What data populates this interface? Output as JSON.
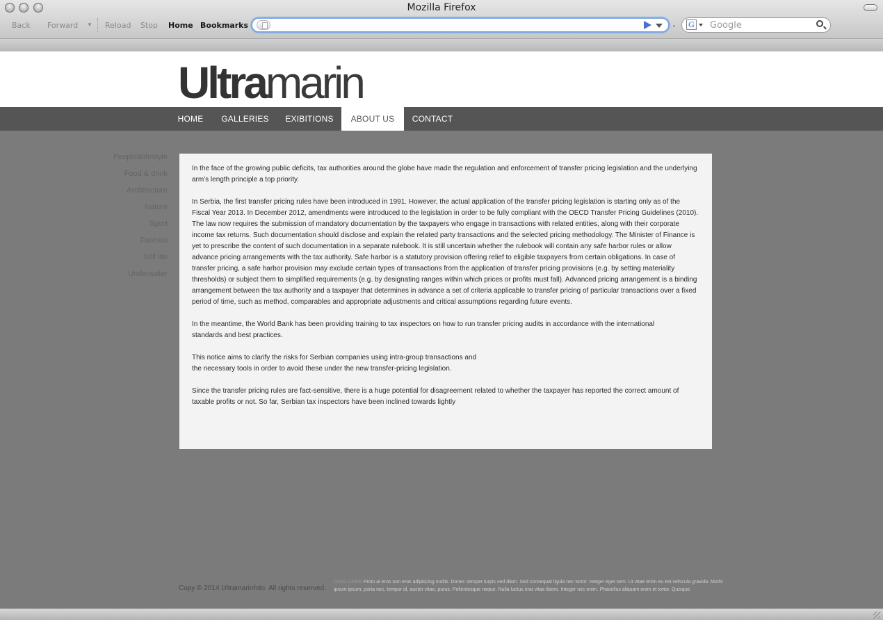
{
  "browser": {
    "title": "Mozilla Firefox",
    "toolbar": {
      "back": "Back",
      "forward": "Forward",
      "reload": "Reload",
      "stop": "Stop",
      "home": "Home",
      "bookmarks": "Bookmarks"
    },
    "url": {
      "value": ""
    },
    "search": {
      "placeholder": "Google",
      "engine_icon": "G"
    }
  },
  "site": {
    "logo_bold": "Ultra",
    "logo_light": "marin",
    "nav": [
      {
        "label": "HOME"
      },
      {
        "label": "GALLERIES"
      },
      {
        "label": "EXIBITIONS"
      },
      {
        "label": "ABOUT US",
        "active": true
      },
      {
        "label": "CONTACT"
      }
    ],
    "sidebar": [
      {
        "label": "People&lifestyle"
      },
      {
        "label": "Food & drink"
      },
      {
        "label": "Architecture"
      },
      {
        "label": "Nature"
      },
      {
        "label": "Sport"
      },
      {
        "label": "Fashion"
      },
      {
        "label": "Still life"
      },
      {
        "label": "Underwater"
      }
    ],
    "content": {
      "paragraphs": [
        "In the face of the growing public deficits, tax authorities around the globe have made the regulation and enforcement of transfer pricing legislation and the underlying arm's length principle a top priority.",
        "In Serbia, the first transfer pricing rules have been introduced in 1991. However, the actual application of the transfer pricing legislation is starting only as of the Fiscal Year 2013. In December 2012, amendments were introduced to the legislation in order to be fully compliant with the OECD Transfer Pricing Guidelines (2010).\nThe law now requires the submission of mandatory documentation by the taxpayers who engage in transactions with related entities, along with their corporate income tax returns. Such documentation should disclose and explain the related party transactions and the selected pricing methodology. The Minister of Finance is yet to prescribe the content of such documentation in a separate rulebook. It is still uncertain whether the rulebook will contain any safe harbor rules or allow advance pricing arrangements with the tax authority. Safe harbor is a statutory provision offering relief to eligible taxpayers from certain obligations. In case of transfer pricing, a safe harbor provision may exclude certain types of transactions from the application of transfer pricing provisions (e.g. by setting materiality thresholds) or subject them to simplified requirements (e.g. by designating ranges within which prices or profits must fall). Advanced pricing arrangement is a binding arrangement between the tax authority and a taxpayer that determines in advance a set of criteria applicable to transfer pricing of particular transactions over a fixed period of time, such as method, comparables and appropriate adjustments and critical assumptions regarding future events.",
        "In the meantime, the World Bank has been providing training to tax inspectors on how to run transfer pricing audits in accordance with the international\nstandards and best practices.",
        "This notice aims to clarify the risks for Serbian companies using intra-group transactions and\nthe necessary tools in order to avoid these under the new transfer-pricing legislation.",
        "Since the transfer pricing rules are fact-sensitive, there is a huge potential for disagreement related to whether the taxpayer has reported the correct amount of taxable profits or not. So far, Serbian tax inspectors have been inclined towards lightly"
      ]
    },
    "footer": {
      "copyright": "Copy © 2014 Ultramarinfoto. All rights reserved.",
      "disclaimer_label": "DISCLAMER",
      "disclaimer_text": "Proin at eros non eros adipiscing mollis. Donec semper turpis sed diam. Sed consequat ligula nec tortor. Integer eget sem. Ut vitae enim eu est vehicula gravida. Morbi ipsum ipsum, porta nec, tempor id, auctor vitae, purus. Pellentesque neque. Nulla luctus erat vitae libero. Integer nec enim. Phasellus aliquam enim et tortor. Quisque."
    }
  },
  "colors": {
    "page_bg": "#7b7b7b",
    "nav_bg": "#555555",
    "content_bg": "#f3f3f3"
  }
}
